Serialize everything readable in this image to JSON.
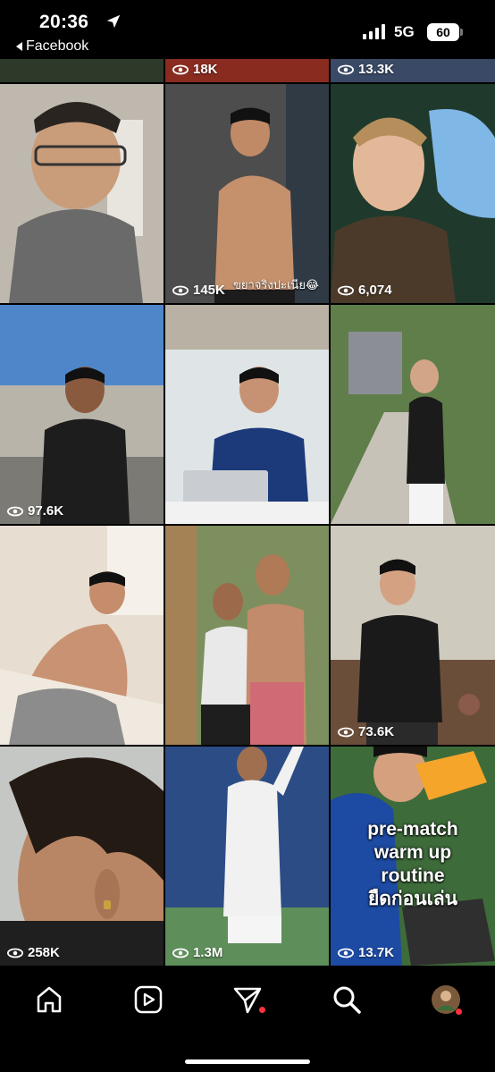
{
  "status_bar": {
    "time": "20:36",
    "back_app": "Facebook",
    "network": "5G",
    "battery": "60"
  },
  "grid": {
    "tiles": [
      {
        "views": "",
        "overlay": "",
        "caption": ""
      },
      {
        "views": "18K",
        "overlay": "",
        "caption": ""
      },
      {
        "views": "13.3K",
        "overlay": "",
        "caption": ""
      },
      {
        "views": "",
        "overlay": "",
        "caption": ""
      },
      {
        "views": "145K",
        "overlay": "ขยาจริงปะเนีย😂",
        "caption": ""
      },
      {
        "views": "6,074",
        "overlay": "",
        "caption": ""
      },
      {
        "views": "97.6K",
        "overlay": "",
        "caption": ""
      },
      {
        "views": "",
        "overlay": "",
        "caption": ""
      },
      {
        "views": "",
        "overlay": "",
        "caption": ""
      },
      {
        "views": "",
        "overlay": "",
        "caption": ""
      },
      {
        "views": "",
        "overlay": "",
        "caption": ""
      },
      {
        "views": "73.6K",
        "overlay": "",
        "caption": ""
      },
      {
        "views": "258K",
        "overlay": "",
        "caption": ""
      },
      {
        "views": "1.3M",
        "overlay": "",
        "caption": ""
      },
      {
        "views": "13.7K",
        "overlay": "",
        "caption": "pre-match warm up routine ยืดก่อนเล่น"
      }
    ],
    "tile_colors": [
      "#2d3a2a",
      "#8a2b20",
      "#3a4a66",
      "#a8a39a",
      "#6b6b6b",
      "#25362c",
      "#3b5d86",
      "#9fb7c9",
      "#7e8f70",
      "#d8d0c4",
      "#8f7d6a",
      "#6f6a60",
      "#3a3028",
      "#304a77",
      "#1f3f86"
    ]
  },
  "nav": {
    "items": [
      "home-icon",
      "reels-icon",
      "messages-icon",
      "search-icon",
      "profile-avatar"
    ],
    "notification_color": "#ff3040"
  }
}
